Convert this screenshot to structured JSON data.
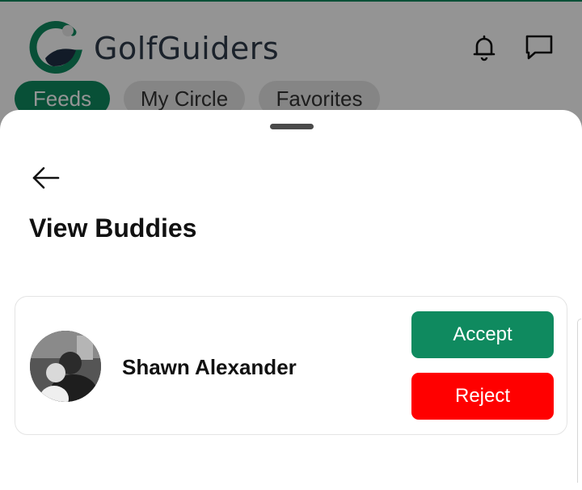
{
  "app": {
    "brand_name": "GolfGuiders",
    "accent_color": "#0f8a5f",
    "icons": [
      "golf-logo-icon",
      "bell-icon",
      "chat-icon"
    ]
  },
  "tabs": [
    {
      "label": "Feeds",
      "active": true
    },
    {
      "label": "My Circle",
      "active": false
    },
    {
      "label": "Favorites",
      "active": false
    }
  ],
  "sheet": {
    "title": "View Buddies",
    "back_icon": "back-arrow-icon",
    "buddies": [
      {
        "name": "Shawn Alexander",
        "accept_label": "Accept",
        "reject_label": "Reject",
        "accept_color": "#0f8a5f",
        "reject_color": "#ff0000"
      }
    ]
  }
}
